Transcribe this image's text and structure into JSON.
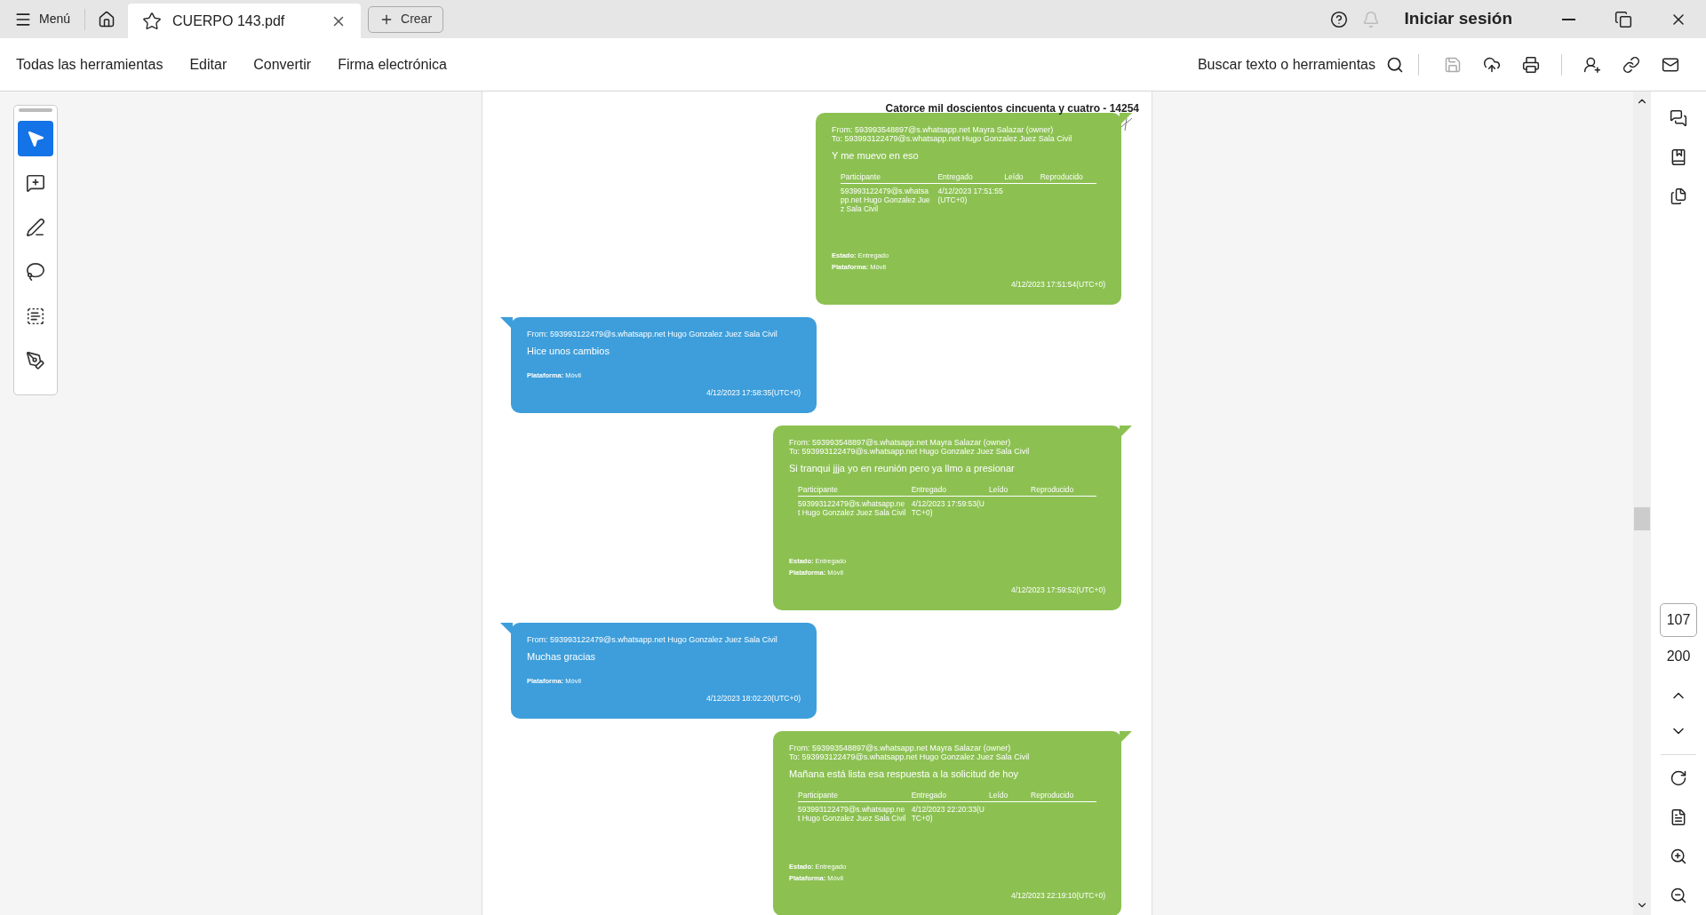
{
  "title_bar": {
    "menu": "Menú",
    "tabs": [
      {
        "label": "CUERPO 143.pdf",
        "selected": true
      }
    ],
    "create": "Crear",
    "sign_in": "Iniciar sesión"
  },
  "toolbar": {
    "items": [
      "Todas las herramientas",
      "Editar",
      "Convertir",
      "Firma electrónica"
    ],
    "search": "Buscar texto o herramientas"
  },
  "tools": [
    {
      "kind": "select",
      "selected": true
    },
    {
      "kind": "comment",
      "selected": false
    },
    {
      "kind": "draw",
      "selected": false
    },
    {
      "kind": "lasso",
      "selected": false
    },
    {
      "kind": "text",
      "selected": false
    },
    {
      "kind": "sign",
      "selected": false
    }
  ],
  "page_header": "Catorce mil doscientos cincuenta y cuatro - 14254",
  "messages": [
    {
      "kind": "sent",
      "from": "From: 593993548897@s.whatsapp.net Mayra Salazar (owner)",
      "to": "To: 593993122479@s.whatsapp.net Hugo Gonzalez Juez Sala Civil",
      "text": "Y me muevo en eso",
      "columns": [
        "Participante",
        "Entregado",
        "Leído",
        "Reproducido"
      ],
      "participant": "593993122479@s.whatsapp.net Hugo Gonzalez Juez Sala Civil",
      "delivered": "4/12/2023 17:51:55(UTC+0)",
      "estado": "**Estado:** Entregado",
      "plataforma": "**Plataforma:** Móvil",
      "time": "4/12/2023 17:51:54(UTC+0)"
    },
    {
      "kind": "received",
      "from": "From: 593993122479@s.whatsapp.net Hugo Gonzalez Juez Sala Civil",
      "text": "Hice unos cambios",
      "plataforma": "**Plataforma:** Móvil",
      "time": "4/12/2023 17:58:35(UTC+0)"
    },
    {
      "kind": "sent",
      "from": "From: 593993548897@s.whatsapp.net Mayra Salazar (owner)",
      "to": "To: 593993122479@s.whatsapp.net Hugo Gonzalez Juez Sala Civil",
      "text": "Si tranqui jjja yo en reunión pero ya llmo a presionar",
      "columns": [
        "Participante",
        "Entregado",
        "Leído",
        "Reproducido"
      ],
      "participant": "593993122479@s.whatsapp.net Hugo Gonzalez Juez Sala Civil",
      "delivered": "4/12/2023 17:59:53(UTC+0)",
      "estado": "**Estado:** Entregado",
      "plataforma": "**Plataforma:** Móvil",
      "time": "4/12/2023 17:59:52(UTC+0)"
    },
    {
      "kind": "received",
      "from": "From: 593993122479@s.whatsapp.net Hugo Gonzalez Juez Sala Civil",
      "text": "Muchas gracias",
      "plataforma": "**Plataforma:** Móvil",
      "time": "4/12/2023 18:02:20(UTC+0)"
    },
    {
      "kind": "sent",
      "from": "From: 593993548897@s.whatsapp.net Mayra Salazar (owner)",
      "to": "To: 593993122479@s.whatsapp.net Hugo Gonzalez Juez Sala Civil",
      "text": "Mañana está lista esa respuesta a la solicitud de hoy",
      "columns": [
        "Participante",
        "Entregado",
        "Leído",
        "Reproducido"
      ],
      "participant": "593993122479@s.whatsapp.net Hugo Gonzalez Juez Sala Civil",
      "delivered": "4/12/2023 22:20:33(UTC+0)",
      "estado": "**Estado:** Entregado",
      "plataforma": "**Plataforma:** Móvil",
      "time": "4/12/2023 22:19:10(UTC+0)"
    }
  ],
  "pager": {
    "current": "107",
    "total": "200"
  }
}
